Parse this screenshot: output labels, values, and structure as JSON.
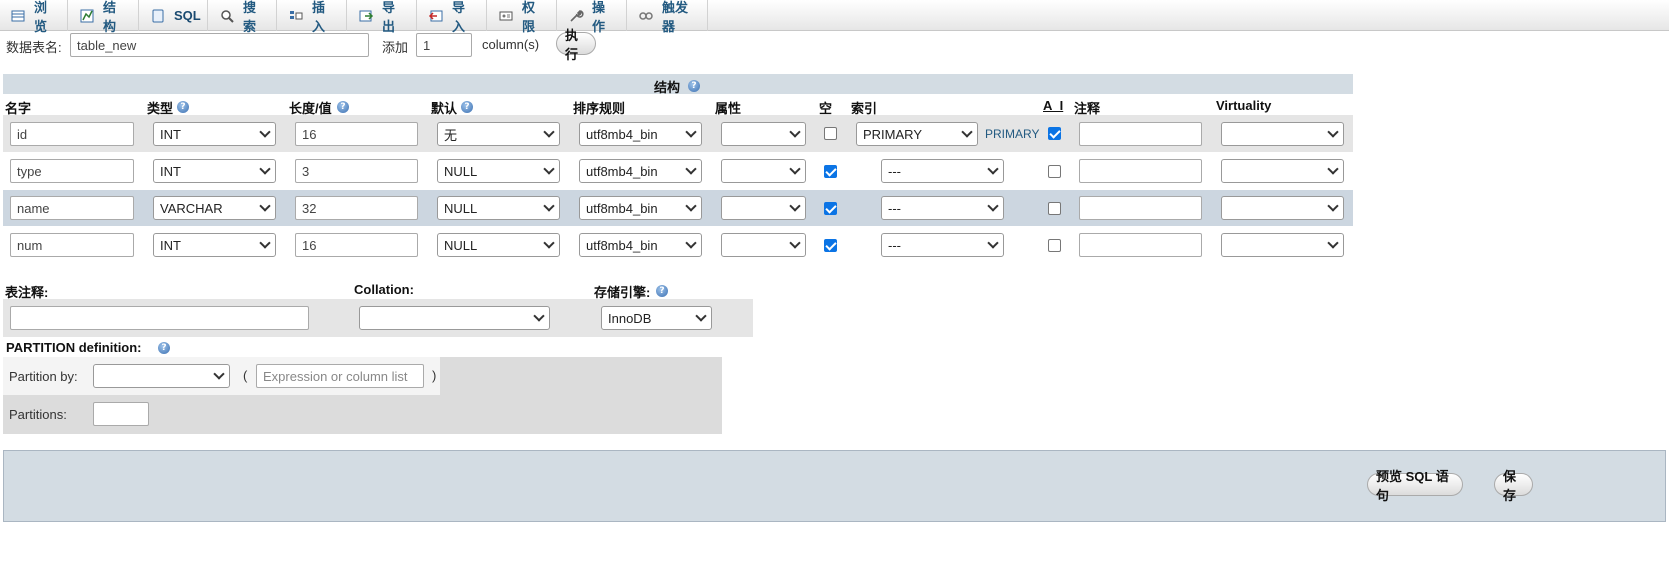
{
  "tabs": [
    {
      "label": "浏览",
      "icon": "browse-icon"
    },
    {
      "label": "结构",
      "icon": "structure-icon"
    },
    {
      "label": "SQL",
      "icon": "sql-icon"
    },
    {
      "label": "搜索",
      "icon": "search-icon"
    },
    {
      "label": "插入",
      "icon": "insert-icon"
    },
    {
      "label": "导出",
      "icon": "export-icon"
    },
    {
      "label": "导入",
      "icon": "import-icon"
    },
    {
      "label": "权限",
      "icon": "privileges-icon"
    },
    {
      "label": "操作",
      "icon": "wrench-icon"
    },
    {
      "label": "触发器",
      "icon": "triggers-icon"
    }
  ],
  "table_name": {
    "label": "数据表名:",
    "value": "table_new"
  },
  "add": {
    "label": "添加",
    "value": "1",
    "unit": "column(s)",
    "go": "执行"
  },
  "structure": {
    "title": "结构",
    "headers": {
      "name": "名字",
      "type": "类型",
      "length": "长度/值",
      "default": "默认",
      "collation": "排序规则",
      "attributes": "属性",
      "null": "空",
      "index": "索引",
      "ai": "A_I",
      "comment": "注释",
      "virtuality": "Virtuality"
    },
    "rows": [
      {
        "name": "id",
        "type": "INT",
        "length": "16",
        "default": "无",
        "collation": "utf8mb4_bin",
        "attributes": "",
        "null": false,
        "index": "PRIMARY",
        "index_note": "PRIMARY",
        "ai": true,
        "comment": "",
        "virtuality": ""
      },
      {
        "name": "type",
        "type": "INT",
        "length": "3",
        "default": "NULL",
        "collation": "utf8mb4_bin",
        "attributes": "",
        "null": true,
        "index": "---",
        "index_note": "",
        "ai": false,
        "comment": "",
        "virtuality": ""
      },
      {
        "name": "name",
        "type": "VARCHAR",
        "length": "32",
        "default": "NULL",
        "collation": "utf8mb4_bin",
        "attributes": "",
        "null": true,
        "index": "---",
        "index_note": "",
        "ai": false,
        "comment": "",
        "virtuality": ""
      },
      {
        "name": "num",
        "type": "INT",
        "length": "16",
        "default": "NULL",
        "collation": "utf8mb4_bin",
        "attributes": "",
        "null": true,
        "index": "---",
        "index_note": "",
        "ai": false,
        "comment": "",
        "virtuality": ""
      }
    ]
  },
  "table_options": {
    "comment_label": "表注释:",
    "comment_value": "",
    "collation_label": "Collation:",
    "collation_value": "",
    "engine_label": "存储引擎:",
    "engine_value": "InnoDB"
  },
  "partition": {
    "title": "PARTITION definition:",
    "by_label": "Partition by:",
    "by_value": "",
    "open_paren": "(",
    "close_paren": ")",
    "expr_placeholder": "Expression or column list",
    "partitions_label": "Partitions:",
    "partitions_value": ""
  },
  "footer": {
    "preview_sql": "预览 SQL 语句",
    "save": "保存"
  }
}
